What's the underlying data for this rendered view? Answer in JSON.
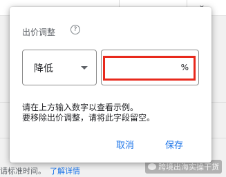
{
  "dialog": {
    "title": "出价调整",
    "help_icon_glyph": "?",
    "direction_select": {
      "value": "降低"
    },
    "amount_input": {
      "value": "",
      "suffix": "%"
    },
    "hint_line_1": "请在上方输入数字以查看示例。",
    "hint_line_2": "要移除出价调整，请将此字段留空。",
    "cancel_label": "取消",
    "save_label": "保存"
  },
  "background": {
    "footnote_text": "请标准时间。",
    "footnote_link": "了解详情",
    "watermark_text": "跨境出海实操干货"
  },
  "colors": {
    "accent": "#1a73e8",
    "highlight": "#e8291c"
  },
  "icons": {
    "help": "help-circle-icon",
    "dropdown": "dropdown-arrow-icon"
  }
}
